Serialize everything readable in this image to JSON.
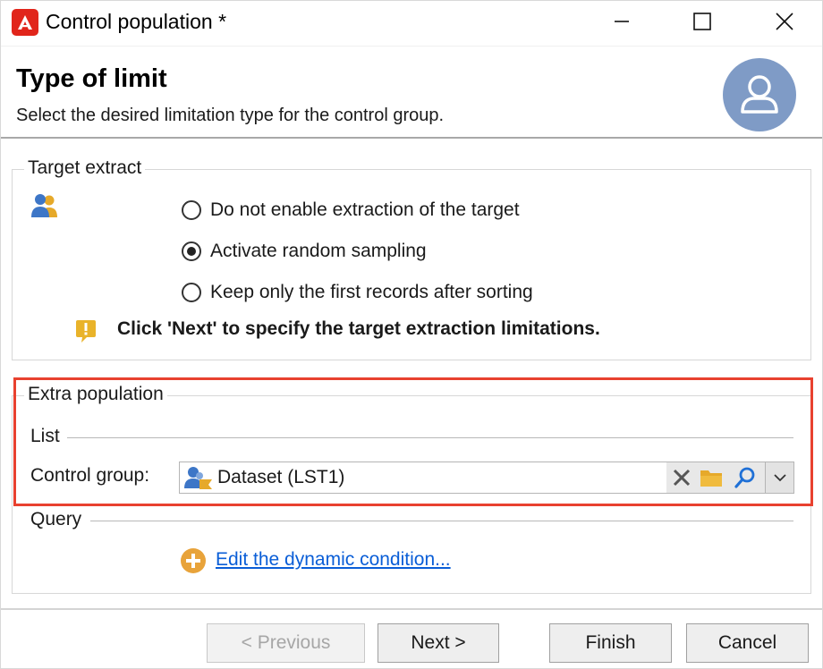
{
  "window": {
    "title": "Control population *",
    "minimize_icon": "minimize-icon",
    "maximize_icon": "maximize-icon",
    "close_icon": "close-icon"
  },
  "header": {
    "title": "Type of limit",
    "subtitle": "Select the desired limitation type for the control group.",
    "avatar_icon": "user-avatar-icon"
  },
  "target_extract": {
    "legend": "Target extract",
    "icon": "users-icon",
    "options": [
      {
        "label": "Do not enable extraction of the target",
        "checked": false
      },
      {
        "label": "Activate random sampling",
        "checked": true
      },
      {
        "label": "Keep only the first records after sorting",
        "checked": false
      }
    ],
    "hint": "Click 'Next' to specify the target extraction limitations."
  },
  "extra_population": {
    "legend": "Extra population",
    "list_label": "List",
    "control_group_label": "Control group:",
    "control_group_value": "Dataset (LST1)",
    "query_label": "Query",
    "edit_link": "Edit the dynamic condition..."
  },
  "footer": {
    "previous_label": "< Previous",
    "next_label": "Next >",
    "finish_label": "Finish",
    "cancel_label": "Cancel"
  },
  "colors": {
    "accent_red": "#e1251b",
    "highlight_red": "#e8412f",
    "link_blue": "#0a5ed7",
    "avatar_blue": "#7f9bc6",
    "warning_yellow": "#e9b32a",
    "folder_yellow": "#e6a92a",
    "plus_orange": "#e8a33a"
  }
}
